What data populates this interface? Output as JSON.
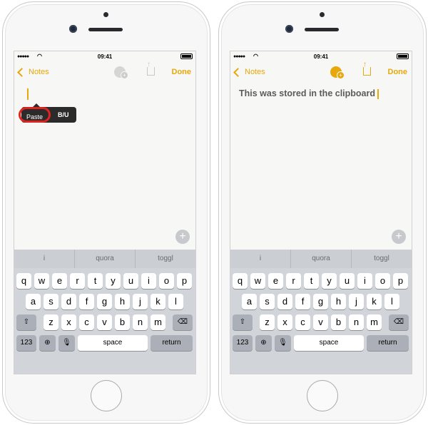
{
  "status": {
    "time": "09:41"
  },
  "phones": [
    {
      "nav": {
        "back_label": "Notes",
        "done_label": "Done"
      },
      "popup": {
        "paste_label": "Paste",
        "format_label": "B/U"
      },
      "note_text": ""
    },
    {
      "nav": {
        "back_label": "Notes",
        "done_label": "Done"
      },
      "note_text": "This was stored in the clipboard"
    }
  ],
  "keyboard": {
    "suggestions": [
      "i",
      "quora",
      "toggl"
    ],
    "row1": [
      "q",
      "w",
      "e",
      "r",
      "t",
      "y",
      "u",
      "i",
      "o",
      "p"
    ],
    "row2": [
      "a",
      "s",
      "d",
      "f",
      "g",
      "h",
      "j",
      "k",
      "l"
    ],
    "row3": [
      "z",
      "x",
      "c",
      "v",
      "b",
      "n",
      "m"
    ],
    "numbers_label": "123",
    "space_label": "space",
    "return_label": "return"
  },
  "icons": {
    "back": "chevron-left-icon",
    "collaborator": "add-person-icon",
    "share": "share-icon",
    "add": "plus-icon",
    "shift": "shift-icon",
    "delete": "delete-icon",
    "globe": "globe-icon",
    "mic": "microphone-icon"
  },
  "colors": {
    "accent": "#e6a80c",
    "highlight": "#e0231f"
  }
}
